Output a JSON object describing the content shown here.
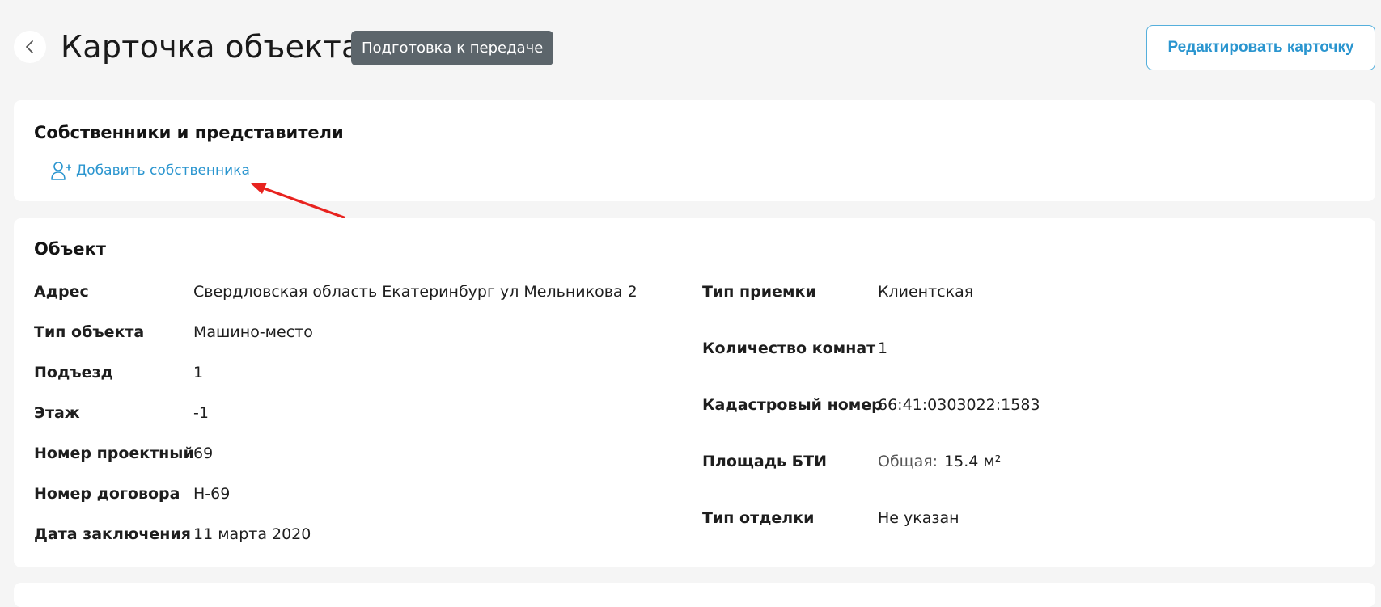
{
  "header": {
    "title": "Карточка объекта",
    "status": "Подготовка к передаче",
    "edit_button": "Редактировать карточку",
    "back_icon": "chevron-left-icon"
  },
  "owners": {
    "title": "Собственники и представители",
    "add_owner_label": "Добавить собственника",
    "add_owner_icon": "user-plus-icon"
  },
  "annotation": {
    "arrow_color": "#e8231f"
  },
  "object": {
    "title": "Объект",
    "left_fields": [
      {
        "label": "Адрес",
        "value": "Свердловская область Екатеринбург ул Мельникова 2"
      },
      {
        "label": "Тип объекта",
        "value": "Машино-место"
      },
      {
        "label": "Подъезд",
        "value": "1"
      },
      {
        "label": "Этаж",
        "value": "-1"
      },
      {
        "label": "Номер проектный",
        "value": "69"
      },
      {
        "label": "Номер договора",
        "value": "Н-69"
      },
      {
        "label": "Дата заключения",
        "value": "11 марта 2020"
      }
    ],
    "right_fields": [
      {
        "label": "Тип приемки",
        "value": "Клиентская"
      },
      {
        "label": "Количество комнат",
        "value": "1"
      },
      {
        "label": "Кадастровый номер",
        "value": "66:41:0303022:1583"
      },
      {
        "label": "Площадь БТИ",
        "sub_label": "Общая:",
        "value": "15.4 м²"
      },
      {
        "label": "Тип отделки",
        "value": "Не указан"
      }
    ]
  },
  "colors": {
    "accent": "#2a95cf",
    "badge": "#5c656b",
    "background": "#f5f5f5"
  }
}
